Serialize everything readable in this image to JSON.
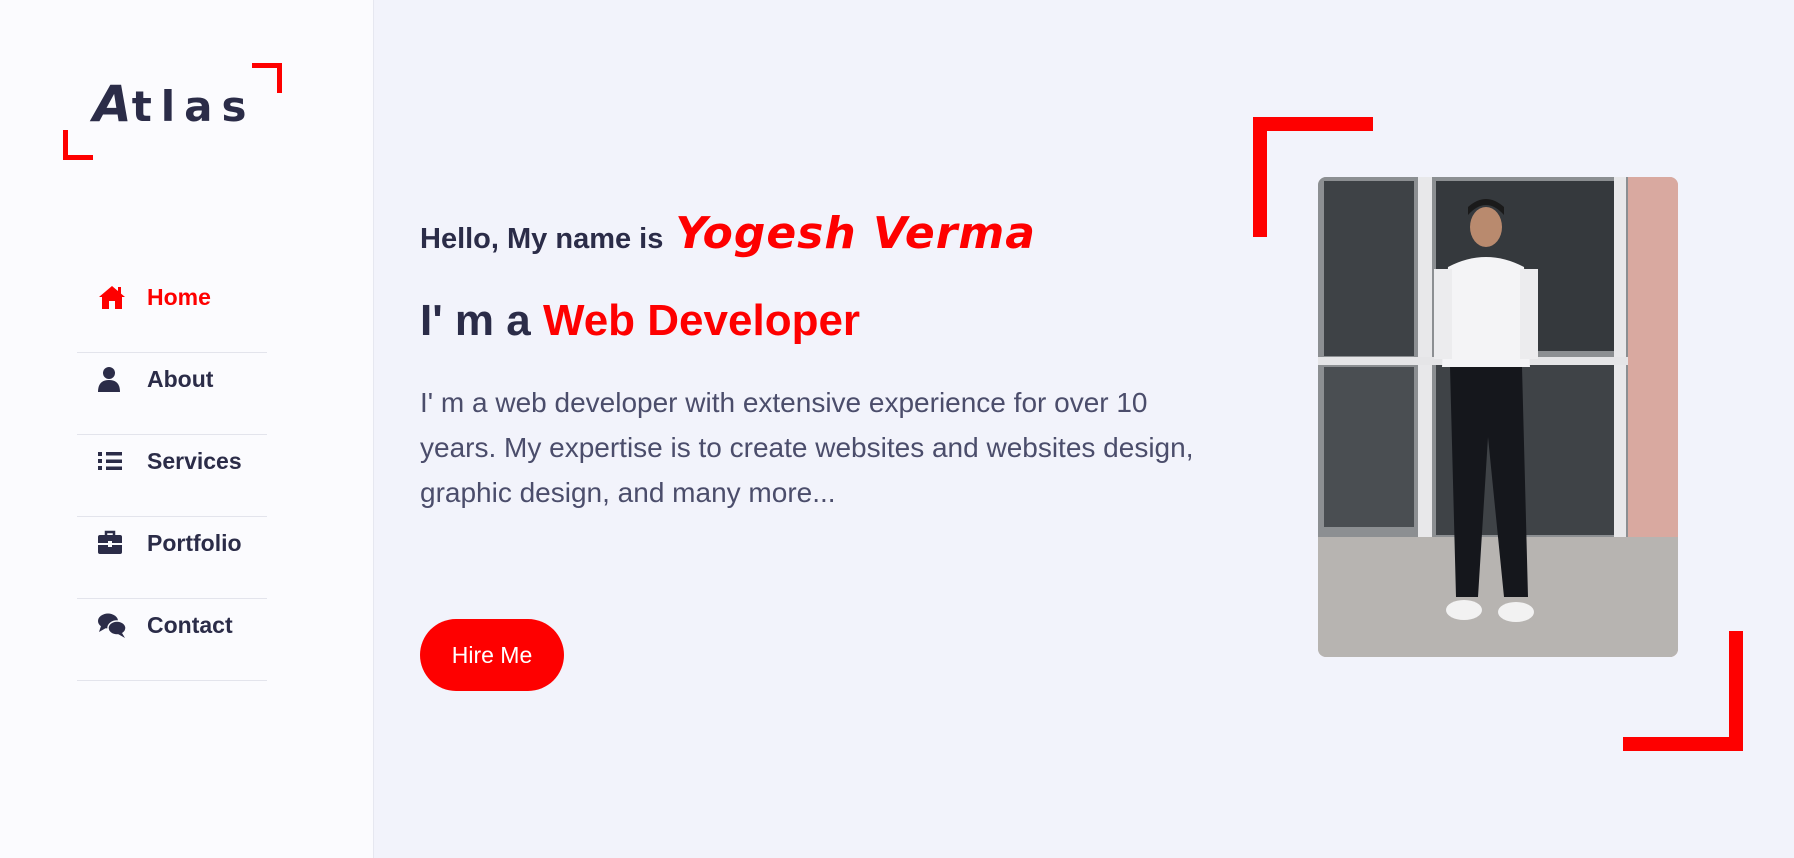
{
  "sidebar": {
    "logo": {
      "first_letter": "A",
      "rest": "tlas"
    },
    "items": [
      {
        "label": "Home",
        "icon": "home-icon",
        "active": true
      },
      {
        "label": "About",
        "icon": "user-icon",
        "active": false
      },
      {
        "label": "Services",
        "icon": "list-icon",
        "active": false
      },
      {
        "label": "Portfolio",
        "icon": "briefcase-icon",
        "active": false
      },
      {
        "label": "Contact",
        "icon": "comments-icon",
        "active": false
      }
    ]
  },
  "hero": {
    "greeting": "Hello, My name is",
    "name": "Yogesh Verma",
    "role_prefix": "I' m a",
    "role": "Web Developer",
    "description": "I' m a web developer with extensive experience for over 10 years. My expertise is to create websites and websites design, graphic design, and many more...",
    "button_label": "Hire Me"
  },
  "colors": {
    "accent": "#fe0000",
    "text": "#2b2c48",
    "background": "#f2f3fb",
    "sidebar": "#fbfbfe"
  }
}
